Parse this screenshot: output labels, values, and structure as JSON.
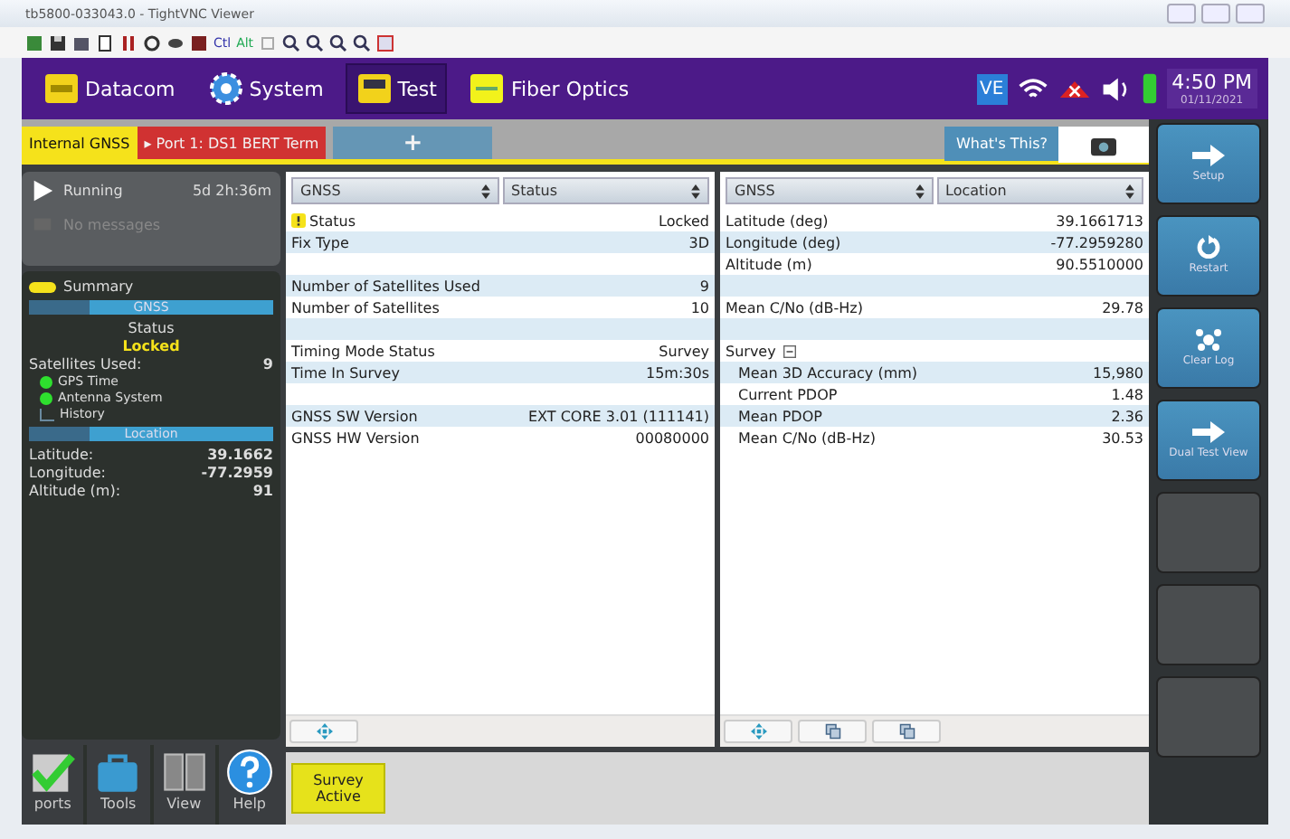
{
  "window": {
    "title": "tb5800-033043.0 - TightVNC Viewer"
  },
  "toolbar": {
    "keys": [
      "Ctl",
      "Alt"
    ]
  },
  "nav": {
    "items": [
      {
        "label": "Datacom",
        "kind": "datacom",
        "selected": false
      },
      {
        "label": "System",
        "kind": "system",
        "selected": false
      },
      {
        "label": "Test",
        "kind": "test",
        "selected": true
      },
      {
        "label": "Fiber Optics",
        "kind": "fiber",
        "selected": false
      }
    ],
    "badge": "VE",
    "time": "4:50 PM",
    "date": "01/11/2021"
  },
  "test_tabs": [
    {
      "label": "Internal GNSS",
      "kind": "gnss",
      "selected": true
    },
    {
      "label": "▸ Port 1: DS1 BERT Term",
      "kind": "port",
      "selected": false
    },
    {
      "label": "+",
      "kind": "add",
      "selected": false
    }
  ],
  "whats_this": "What's This?",
  "run": {
    "state": "Running",
    "duration": "5d 2h:36m",
    "messages": "No messages"
  },
  "summary": {
    "label": "Summary",
    "gnss_header": "GNSS",
    "status_label": "Status",
    "status_value": "Locked",
    "sats_label": "Satellites Used:",
    "sats_value": "9",
    "tree": [
      {
        "label": "GPS Time",
        "led": true
      },
      {
        "label": "Antenna System",
        "led": true
      },
      {
        "label": "History",
        "led": false
      }
    ],
    "location_header": "Location",
    "location": [
      {
        "label": "Latitude:",
        "value": "39.1662"
      },
      {
        "label": "Longitude:",
        "value": "-77.2959"
      },
      {
        "label": "Altitude (m):",
        "value": "91"
      }
    ]
  },
  "bottom_tools": [
    {
      "label": "ports",
      "kind": "reports"
    },
    {
      "label": "Tools",
      "kind": "tools"
    },
    {
      "label": "View",
      "kind": "view"
    },
    {
      "label": "Help",
      "kind": "help"
    }
  ],
  "panes": [
    {
      "selectors": [
        "GNSS",
        "Status"
      ],
      "rows": [
        {
          "label": "Status",
          "value": "Locked",
          "warning": true
        },
        {
          "label": "Fix Type",
          "value": "3D"
        },
        {},
        {
          "label": "Number of Satellites Used",
          "value": "9"
        },
        {
          "label": "Number of Satellites",
          "value": "10"
        },
        {},
        {
          "label": "Timing Mode Status",
          "value": "Survey"
        },
        {
          "label": "Time In Survey",
          "value": "15m:30s"
        },
        {},
        {
          "label": "GNSS SW Version",
          "value": "EXT CORE 3.01 (111141)"
        },
        {
          "label": "GNSS HW Version",
          "value": "00080000"
        }
      ],
      "footer": [
        {
          "kind": "move"
        }
      ]
    },
    {
      "selectors": [
        "GNSS",
        "Location"
      ],
      "rows": [
        {
          "label": "Latitude (deg)",
          "value": "39.1661713"
        },
        {
          "label": "Longitude (deg)",
          "value": "-77.2959280"
        },
        {
          "label": "Altitude (m)",
          "value": "90.5510000"
        },
        {},
        {
          "label": "Mean C/No (dB-Hz)",
          "value": "29.78"
        },
        {},
        {
          "label": "Survey",
          "expanded": true,
          "children": [
            {
              "label": "Mean 3D Accuracy (mm)",
              "value": "15,980"
            },
            {
              "label": "Current PDOP",
              "value": "1.48"
            },
            {
              "label": "Mean PDOP",
              "value": "2.36"
            },
            {
              "label": "Mean C/No (dB-Hz)",
              "value": "30.53"
            }
          ]
        }
      ],
      "footer": [
        {
          "kind": "move"
        },
        {
          "kind": "copy"
        },
        {
          "kind": "copy"
        }
      ]
    }
  ],
  "status_chip": "Survey Active",
  "actions": [
    {
      "label": "Setup",
      "kind": "arrow"
    },
    {
      "label": "Restart",
      "kind": "restart"
    },
    {
      "label": "Clear Log",
      "kind": "clear"
    },
    {
      "label": "Dual Test View",
      "kind": "arrow"
    },
    {
      "kind": "empty"
    },
    {
      "kind": "empty"
    },
    {
      "kind": "empty"
    }
  ]
}
